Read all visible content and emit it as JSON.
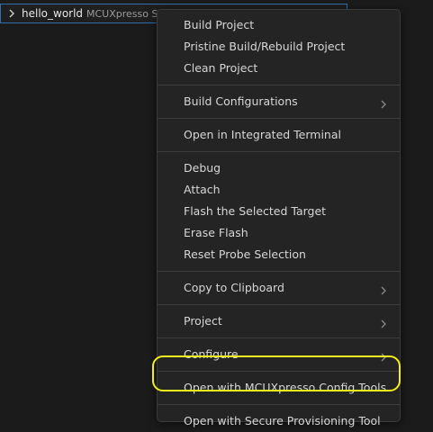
{
  "tree": {
    "name": "hello_world",
    "description": "MCUXpresso SDK"
  },
  "menu": {
    "groups": [
      {
        "items": [
          {
            "label": "Build Project",
            "submenu": false
          },
          {
            "label": "Pristine Build/Rebuild Project",
            "submenu": false
          },
          {
            "label": "Clean Project",
            "submenu": false
          }
        ]
      },
      {
        "items": [
          {
            "label": "Build Configurations",
            "submenu": true
          }
        ]
      },
      {
        "items": [
          {
            "label": "Open in Integrated Terminal",
            "submenu": false
          }
        ]
      },
      {
        "items": [
          {
            "label": "Debug",
            "submenu": false
          },
          {
            "label": "Attach",
            "submenu": false
          },
          {
            "label": "Flash the Selected Target",
            "submenu": false
          },
          {
            "label": "Erase Flash",
            "submenu": false
          },
          {
            "label": "Reset Probe Selection",
            "submenu": false
          }
        ]
      },
      {
        "items": [
          {
            "label": "Copy to Clipboard",
            "submenu": true
          }
        ]
      },
      {
        "items": [
          {
            "label": "Project",
            "submenu": true
          }
        ]
      },
      {
        "items": [
          {
            "label": "Configure",
            "submenu": true
          }
        ]
      },
      {
        "items": [
          {
            "label": "Open with MCUXpresso Config Tools",
            "submenu": false
          }
        ]
      },
      {
        "items": [
          {
            "label": "Open with Secure Provisioning Tool",
            "submenu": false
          }
        ]
      }
    ]
  },
  "colors": {
    "highlight_ring": "#f2ed1c",
    "menu_background": "#242425",
    "tree_selection_border": "#2f6fb0"
  }
}
